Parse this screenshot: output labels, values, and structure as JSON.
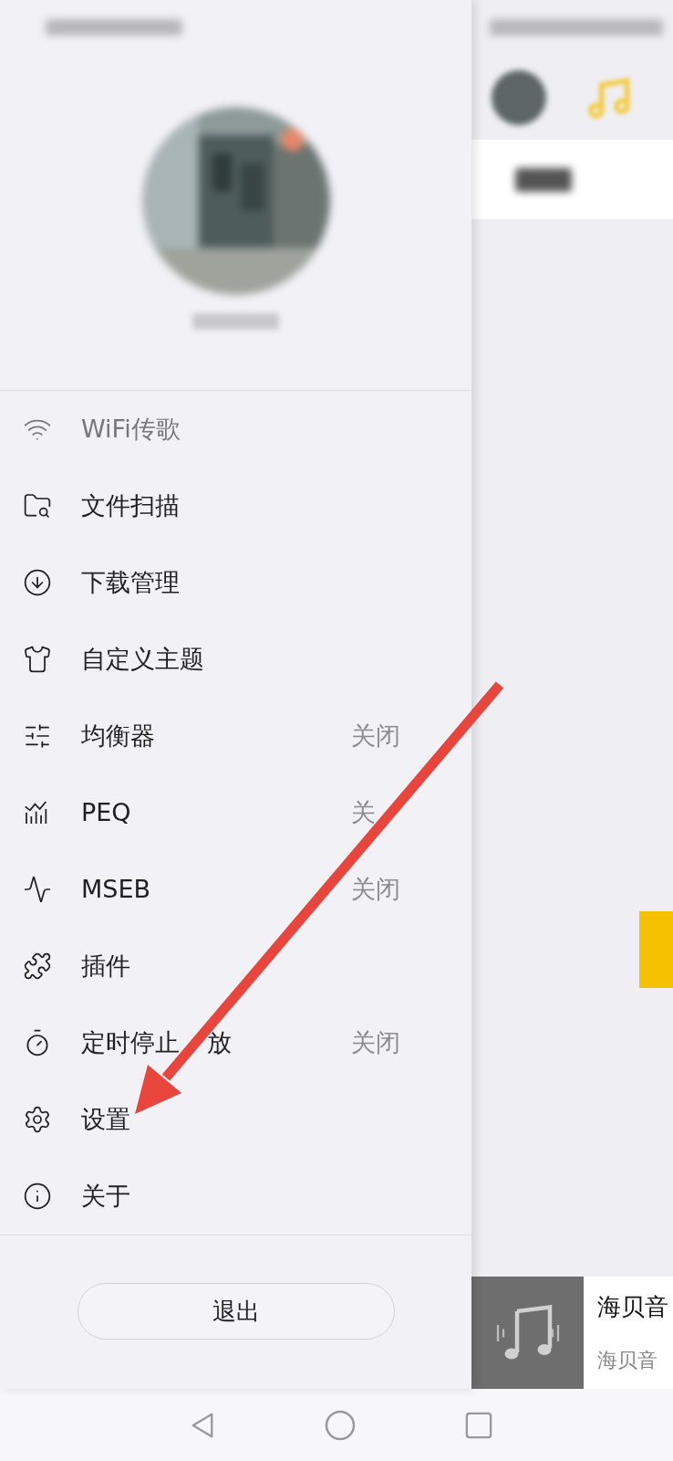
{
  "drawer": {
    "menu": [
      {
        "label": "WiFi传歌",
        "disabled": true
      },
      {
        "label": "文件扫描",
        "disabled": false
      },
      {
        "label": "下载管理",
        "disabled": false
      },
      {
        "label": "自定义主题",
        "disabled": false
      },
      {
        "label": "均衡器",
        "value": "关闭",
        "disabled": false
      },
      {
        "label": "PEQ",
        "value": "关",
        "disabled": false
      },
      {
        "label": "MSEB",
        "value": "关闭",
        "disabled": false
      },
      {
        "label": "插件",
        "disabled": false
      },
      {
        "label": "定时停止",
        "label_after_cover": "放",
        "value": "关闭",
        "disabled": false
      },
      {
        "label": "设置",
        "disabled": false
      },
      {
        "label": "关于",
        "disabled": false
      }
    ],
    "logout_button": "退出"
  },
  "main": {
    "mini_player": {
      "title": "海贝音",
      "subtitle": "海贝音"
    }
  }
}
